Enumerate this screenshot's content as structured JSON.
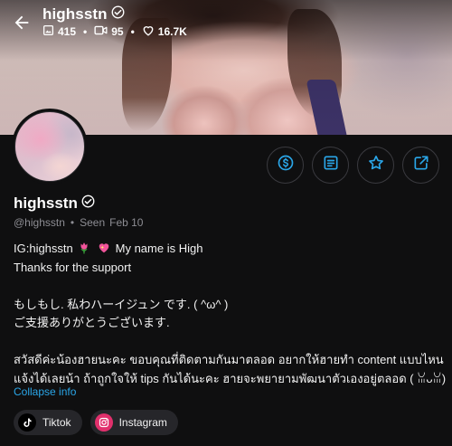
{
  "header": {
    "title": "highsstn",
    "stats": {
      "posts": "415",
      "videos": "95",
      "likes": "16.7K"
    }
  },
  "profile": {
    "display_name": "highsstn",
    "handle": "@highsstn",
    "seen_label": "Seen",
    "seen_date": "Feb 10"
  },
  "bio": {
    "line1_prefix": "IG:highsstn",
    "line1_suffix": "My name is High",
    "line2": "Thanks for the support",
    "line3": "もしもし. 私わハーイジュン です. ( ^ω^ )",
    "line4": "ご支援ありがとうございます.",
    "line5": "สวัสดีค่ะน้องฮายนะคะ ขอบคุณที่ติดตามกันมาตลอด อยากให้ฮายทำ content แบบไหน",
    "line6": "แจ้งได้เลยน้า ถ้าถูกใจให้ tips กันได้นะคะ ฮายจะพยายามพัฒนาตัวเองอยู่ตลอด ( ꈍᴗꈍ)"
  },
  "collapse_label": "Collapse info",
  "socials": [
    {
      "label": "Tiktok",
      "icon": "tiktok-icon"
    },
    {
      "label": "Instagram",
      "icon": "instagram-icon"
    }
  ],
  "colors": {
    "accent": "#2aa6e8",
    "background": "#0f0f10",
    "instagram": "#e1306c"
  }
}
